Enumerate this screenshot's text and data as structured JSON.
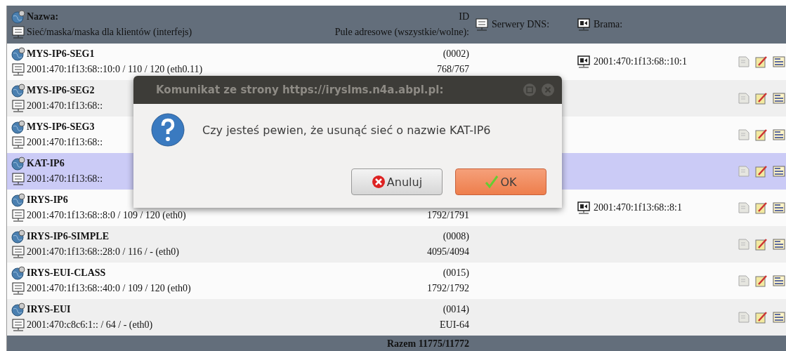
{
  "table": {
    "header": {
      "name": "Nazwa:",
      "network": "Sieć/maska/maska dla klientów (interfejs)",
      "id": "ID",
      "pools": "Pule adresowe (wszystkie/wolne):",
      "dns": "Serwery DNS:",
      "gateway": "Brama:"
    },
    "rows": [
      {
        "name": "MYS-IP6-SEG1",
        "network": "2001:470:1f13:68::10:0 / 110 / 120 (eth0.11)",
        "id": "(0002)",
        "pools": "768/767",
        "gateway": "2001:470:1f13:68::10:1",
        "selected": false
      },
      {
        "name": "MYS-IP6-SEG2",
        "network": "2001:470:1f13:68::",
        "selected": false
      },
      {
        "name": "MYS-IP6-SEG3",
        "network": "2001:470:1f13:68::",
        "selected": false
      },
      {
        "name": "KAT-IP6",
        "network": "2001:470:1f13:68::",
        "selected": true
      },
      {
        "name": "IRYS-IP6",
        "network": "2001:470:1f13:68::8:0 / 109 / 120 (eth0)",
        "pools": "1792/1791",
        "gateway": "2001:470:1f13:68::8:1",
        "selected": false
      },
      {
        "name": "IRYS-IP6-SIMPLE",
        "network": "2001:470:1f13:68::28:0 / 116 / - (eth0)",
        "id": "(0008)",
        "pools": "4095/4094",
        "selected": false
      },
      {
        "name": "IRYS-EUI-CLASS",
        "network": "2001:470:1f13:68::40:0 / 109 / 120 (eth0)",
        "id": "(0015)",
        "pools": "1792/1792",
        "selected": false
      },
      {
        "name": "IRYS-EUI",
        "network": "2001:470:c8c6:1:: / 64 / - (eth0)",
        "id": "(0014)",
        "pools": "EUI-64",
        "selected": false
      }
    ],
    "total": "Razem 11775/11772"
  },
  "dialog": {
    "title": "Komunikat ze strony https://iryslms.n4a.abpl.pl:",
    "message": "Czy jesteś pewien, że usunąć sieć o nazwie KAT-IP6",
    "buttons": [
      {
        "label": "Anuluj",
        "kind": "cancel"
      },
      {
        "label": "OK",
        "kind": "ok"
      }
    ]
  }
}
